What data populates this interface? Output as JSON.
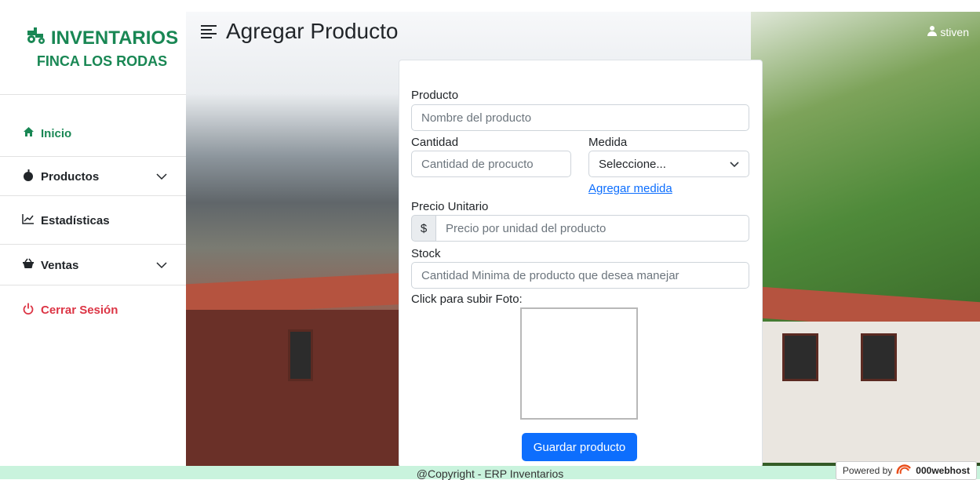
{
  "brand": {
    "title": "INVENTARIOS",
    "subtitle": "FINCA LOS RODAS",
    "icon": "tractor-icon",
    "color": "#198754"
  },
  "header": {
    "title": "Agregar Producto",
    "menu_icon": "menu-lines-icon",
    "user": "stiven"
  },
  "sidebar": {
    "items": [
      {
        "label": "Inicio",
        "icon": "home-icon",
        "active": true
      },
      {
        "label": "Productos",
        "icon": "apple-icon",
        "has_submenu": true
      },
      {
        "label": "Estadísticas",
        "icon": "chart-line-icon"
      },
      {
        "label": "Ventas",
        "icon": "basket-icon",
        "has_submenu": true
      },
      {
        "label": "Cerrar Sesión",
        "icon": "power-icon",
        "danger": true
      }
    ]
  },
  "form": {
    "producto_label": "Producto",
    "producto_placeholder": "Nombre del producto",
    "cantidad_label": "Cantidad",
    "cantidad_placeholder": "Cantidad de procucto",
    "medida_label": "Medida",
    "medida_value": "Seleccione...",
    "agregar_medida": "Agregar medida",
    "precio_label": "Precio Unitario",
    "precio_prefix": "$",
    "precio_placeholder": "Precio por unidad del producto",
    "stock_label": "Stock",
    "stock_placeholder": "Cantidad Minima de producto que desea manejar",
    "foto_label": "Click para subir Foto:",
    "submit": "Guardar producto"
  },
  "footer": {
    "copyright": "@Copyright - ERP Inventarios",
    "powered_by": "Powered by",
    "host": "000webhost"
  },
  "colors": {
    "primary": "#0d6efd",
    "success": "#198754",
    "danger": "#dc3545",
    "footer_bg": "#c9f3dd"
  }
}
